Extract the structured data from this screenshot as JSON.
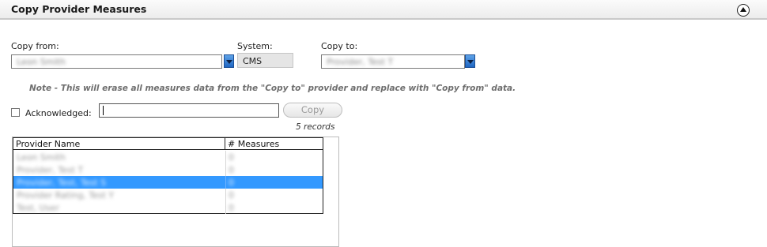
{
  "panel": {
    "title": "Copy Provider Measures"
  },
  "form": {
    "copy_from_label": "Copy from:",
    "copy_from_value": "Leon Smith",
    "system_label": "System:",
    "system_value": "CMS",
    "copy_to_label": "Copy to:",
    "copy_to_value": "Provider, Test T",
    "note": "Note - This will erase all measures data from the \"Copy to\" provider and replace with \"Copy from\" data.",
    "acknowledged_label": "Acknowledged:",
    "acknowledged_checked": false,
    "acknowledged_input_value": "",
    "copy_button": "Copy",
    "records_count": "5 records"
  },
  "grid": {
    "columns": [
      "Provider Name",
      "# Measures"
    ],
    "rows": [
      {
        "name": "Leon Smith",
        "measures": "0",
        "selected": false
      },
      {
        "name": "Provider, Test T",
        "measures": "0",
        "selected": false
      },
      {
        "name": "Provider, Test, Test S",
        "measures": "0",
        "selected": true
      },
      {
        "name": "Provider Rating, Test Y",
        "measures": "0",
        "selected": false
      },
      {
        "name": "Test, User",
        "measures": "0",
        "selected": false
      }
    ]
  },
  "colors": {
    "selection": "#3399ff",
    "dropdown_button": "#1f66c2"
  }
}
